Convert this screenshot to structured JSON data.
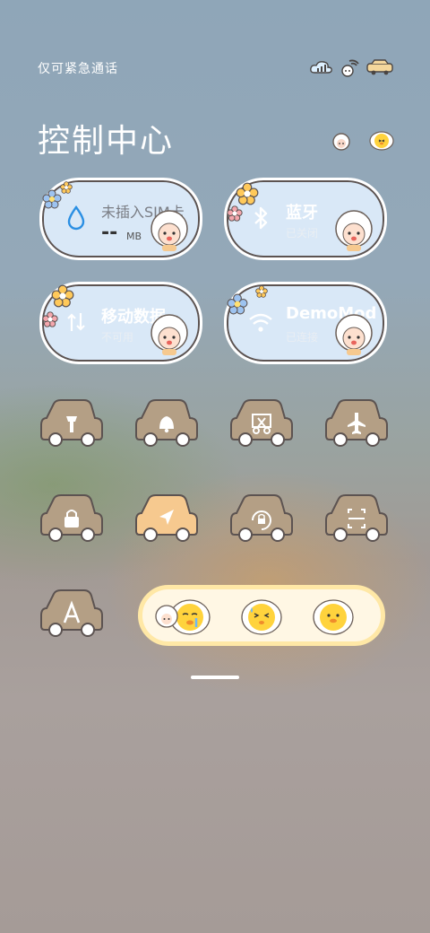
{
  "status_bar": {
    "carrier_text": "仅可紧急通话"
  },
  "header": {
    "title": "控制中心"
  },
  "tiles": {
    "sim": {
      "label": "未插入SIM卡",
      "value": "--",
      "unit": "MB"
    },
    "bluetooth": {
      "label": "蓝牙",
      "sub": "已关闭"
    },
    "mobile_data": {
      "label": "移动数据",
      "sub": "不可用"
    },
    "wifi": {
      "label": "DemoMod",
      "sub": "已连接"
    }
  },
  "toggles": [
    {
      "name": "flashlight",
      "icon": "flashlight-icon",
      "active": false
    },
    {
      "name": "sound",
      "icon": "bell-icon",
      "active": false
    },
    {
      "name": "screenshot",
      "icon": "scissors-icon",
      "active": false
    },
    {
      "name": "airplane",
      "icon": "airplane-icon",
      "active": false
    },
    {
      "name": "lock",
      "icon": "lock-icon",
      "active": false
    },
    {
      "name": "location",
      "icon": "location-arrow-icon",
      "active": true
    },
    {
      "name": "rotation-lock",
      "icon": "rotation-lock-icon",
      "active": false
    },
    {
      "name": "scan",
      "icon": "scan-icon",
      "active": false
    },
    {
      "name": "font",
      "icon": "letter-a-icon",
      "active": false
    }
  ],
  "colors": {
    "tile_fill": "#d9e8f7",
    "car_inactive": "#b49f85",
    "car_active": "#f6c98f",
    "emoji_bar": "#fff7e4"
  }
}
